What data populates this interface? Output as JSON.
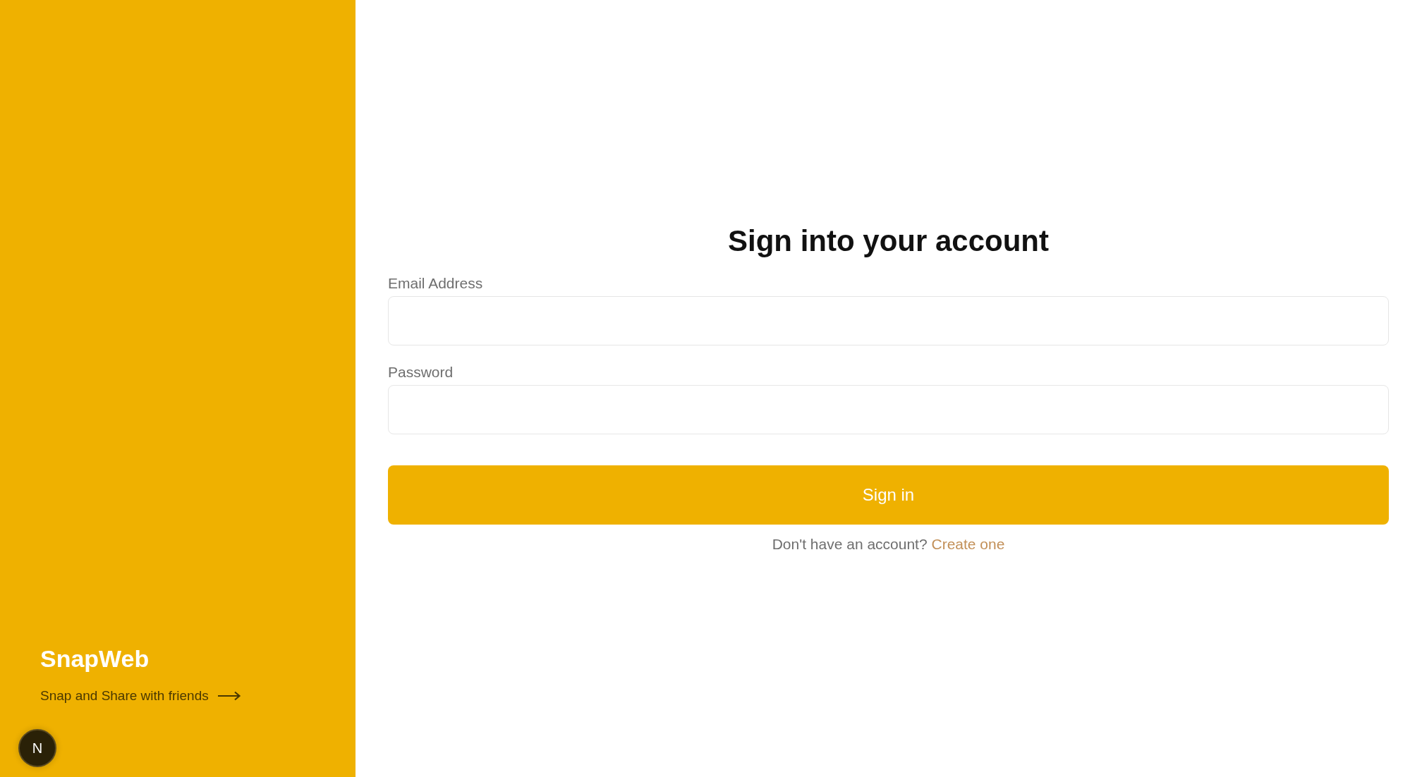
{
  "brand": {
    "name": "SnapWeb",
    "tagline": "Snap and Share with friends"
  },
  "dev_badge": {
    "label": "N"
  },
  "form": {
    "title": "Sign into your account",
    "fields": [
      {
        "label": "Email Address"
      },
      {
        "label": "Password"
      }
    ],
    "submit": "Sign in",
    "footer": {
      "text": "Don't have an account?",
      "link": "Create one"
    }
  }
}
